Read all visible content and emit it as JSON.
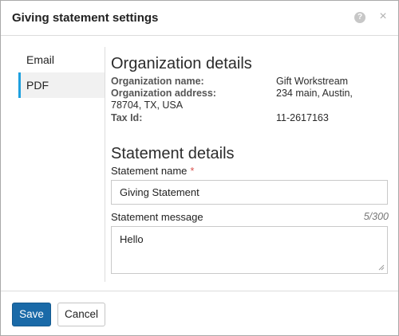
{
  "dialog": {
    "title": "Giving statement settings",
    "help_icon": "?",
    "close_icon": "×"
  },
  "sidebar": {
    "items": [
      {
        "label": "Email",
        "active": false
      },
      {
        "label": "PDF",
        "active": true
      }
    ]
  },
  "organization": {
    "heading": "Organization details",
    "name_label": "Organization name:",
    "name_value": "Gift Workstream",
    "address_label": "Organization address:",
    "address_value_line1": "234 main, Austin,",
    "address_value_line2": "78704, TX, USA",
    "tax_label": "Tax Id:",
    "tax_value": "11-2617163"
  },
  "statement": {
    "heading": "Statement details",
    "name_label": "Statement name",
    "name_required": "*",
    "name_value": "Giving Statement",
    "message_label": "Statement message",
    "message_counter": "5/300",
    "message_value": "Hello"
  },
  "footer": {
    "save_label": "Save",
    "cancel_label": "Cancel"
  },
  "colors": {
    "accent": "#1ea0df",
    "primary_button": "#1a6aa8",
    "required": "#d9534f"
  }
}
